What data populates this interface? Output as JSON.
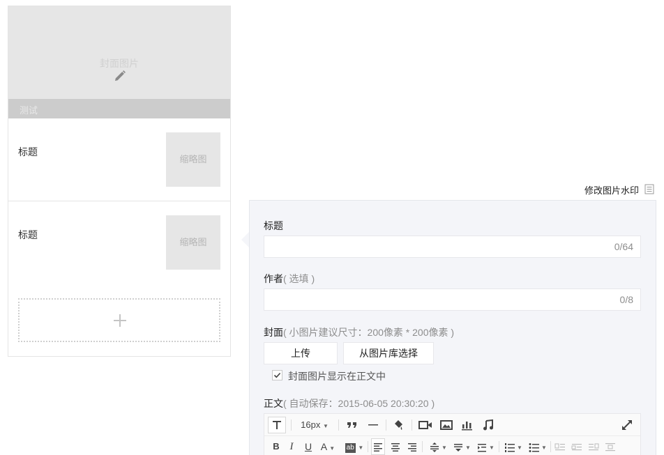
{
  "article_list": {
    "cover": {
      "placeholder": "封面图片",
      "title": "测试"
    },
    "items": [
      {
        "title": "标题",
        "thumb_label": "缩略图"
      },
      {
        "title": "标题",
        "thumb_label": "缩略图"
      }
    ]
  },
  "watermark_link": "修改图片水印",
  "editor": {
    "title_label": "标题",
    "title_value": "",
    "title_counter": "0/64",
    "author_label": "作者",
    "author_hint": "( 选填 )",
    "author_value": "",
    "author_counter": "0/8",
    "cover_label": "封面",
    "cover_hint": "( 小图片建议尺寸：200像素 * 200像素 )",
    "upload_button": "上传",
    "library_button": "从图片库选择",
    "show_cover_label": "封面图片显示在正文中",
    "show_cover_checked": true,
    "body_label": "正文",
    "body_hint": "( 自动保存：2015-06-05 20:30:20 )"
  },
  "toolbar": {
    "font_size": "16px",
    "bold": "B",
    "italic": "I",
    "underline": "U",
    "font_color": "A",
    "highlight": "ab",
    "icons": [
      "text-format-icon",
      "quote-icon",
      "horizontal-rule-icon",
      "format-painter-icon",
      "video-icon",
      "image-icon",
      "chart-icon",
      "music-icon",
      "fullscreen-icon",
      "align-left-icon",
      "align-center-icon",
      "align-right-icon",
      "line-height-icon",
      "paragraph-spacing-icon",
      "indent-icon",
      "ordered-list-icon",
      "unordered-list-icon"
    ]
  },
  "colors": {
    "panel_bg": "#f4f5f9",
    "cover_bg": "#e6e6e6",
    "border": "#e7e7eb"
  }
}
